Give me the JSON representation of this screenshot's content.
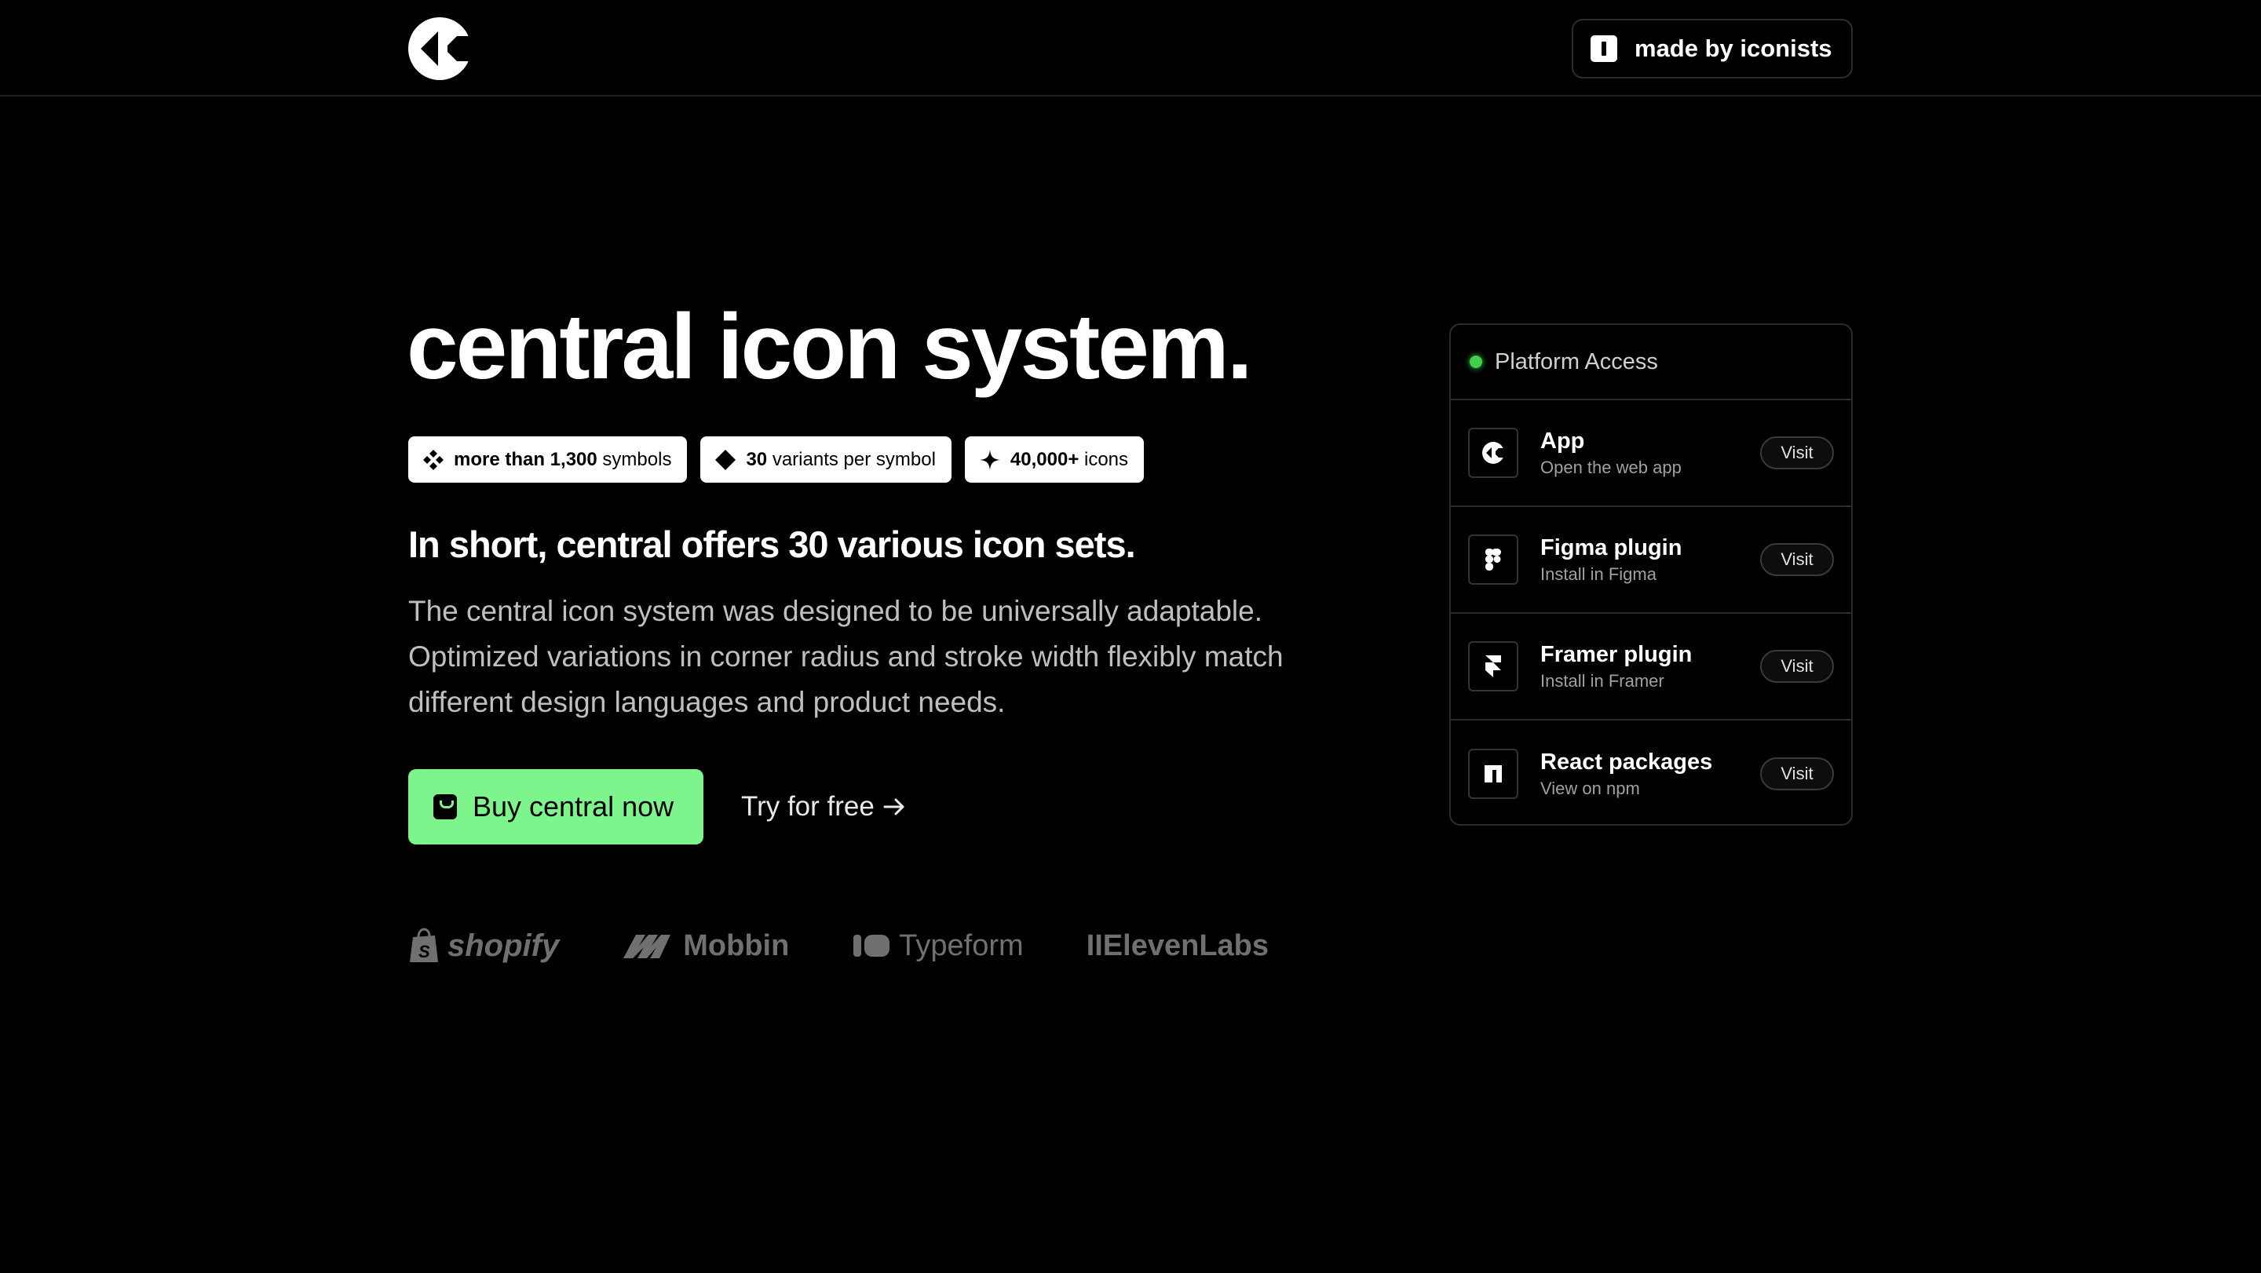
{
  "header": {
    "made_by_label": "made by iconists"
  },
  "hero": {
    "title": "central icon system.",
    "badges": [
      {
        "bold": "more than 1,300",
        "rest": "symbols",
        "icon": "four-diamonds-icon"
      },
      {
        "bold": "30",
        "rest": "variants per symbol",
        "icon": "diamond-icon"
      },
      {
        "bold": "40,000+",
        "rest": "icons",
        "icon": "sparkle-icon"
      }
    ],
    "subheading": "In short, central offers 30 various icon sets.",
    "description": "The central icon system was designed to be universally adaptable. Optimized variations in corner radius and stroke width flexibly match different design languages and product needs.",
    "buy_label": "Buy central now",
    "try_label": "Try for free"
  },
  "logos": {
    "shopify": "shopify",
    "mobbin": "Mobbin",
    "typeform": "Typeform",
    "elevenlabs": "IIElevenLabs"
  },
  "panel": {
    "title": "Platform Access",
    "status_color": "#3fcf4b",
    "rows": [
      {
        "title": "App",
        "subtitle": "Open the web app",
        "action": "Visit",
        "icon": "central-logo-icon"
      },
      {
        "title": "Figma plugin",
        "subtitle": "Install in Figma",
        "action": "Visit",
        "icon": "figma-icon"
      },
      {
        "title": "Framer plugin",
        "subtitle": "Install in Framer",
        "action": "Visit",
        "icon": "framer-icon"
      },
      {
        "title": "React packages",
        "subtitle": "View on npm",
        "action": "Visit",
        "icon": "npm-icon"
      }
    ]
  },
  "colors": {
    "background": "#000000",
    "accent_green": "#7df58c",
    "text_muted": "#bfbfbf",
    "border": "#2c2c2c"
  }
}
